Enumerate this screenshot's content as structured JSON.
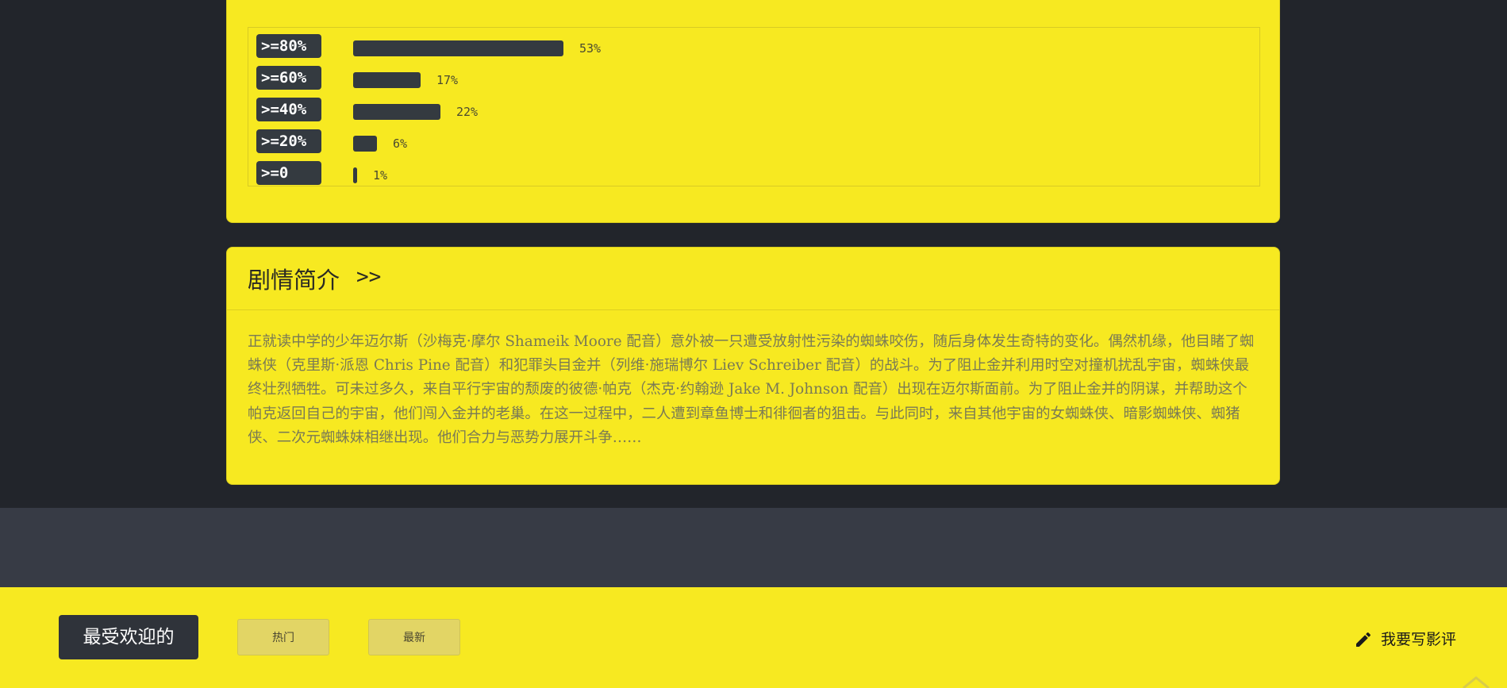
{
  "ratings": [
    {
      "label": ">=80%",
      "percent": 53,
      "percent_text": "53%"
    },
    {
      "label": ">=60%",
      "percent": 17,
      "percent_text": "17%"
    },
    {
      "label": ">=40%",
      "percent": 22,
      "percent_text": "22%"
    },
    {
      "label": ">=20%",
      "percent": 6,
      "percent_text": "6%"
    },
    {
      "label": ">=0",
      "percent": 1,
      "percent_text": "1%"
    }
  ],
  "plot": {
    "title": "剧情简介",
    "arrow": ">>",
    "text": "正就读中学的少年迈尔斯（沙梅克·摩尔 Shameik Moore 配音）意外被一只遭受放射性污染的蜘蛛咬伤，随后身体发生奇特的变化。偶然机缘，他目睹了蜘蛛侠（克里斯·派恩 Chris Pine 配音）和犯罪头目金并（列维·施瑞博尔 Liev Schreiber 配音）的战斗。为了阻止金并利用时空对撞机扰乱宇宙，蜘蛛侠最终壮烈牺牲。可未过多久，来自平行宇宙的颓废的彼德·帕克（杰克·约翰逊 Jake M. Johnson 配音）出现在迈尔斯面前。为了阻止金并的阴谋，并帮助这个帕克返回自己的宇宙，他们闯入金并的老巢。在这一过程中，二人遭到章鱼博士和徘徊者的狙击。与此同时，来自其他宇宙的女蜘蛛侠、暗影蜘蛛侠、蜘猪侠、二次元蜘蛛妹相继出现。他们合力与恶势力展开斗争……"
  },
  "footer": {
    "popular_label": "最受欢迎的",
    "tab_hot": "热门",
    "tab_new": "最新",
    "write_review": "我要写影评",
    "write_icon": "pencil-icon"
  },
  "colors": {
    "accent_yellow": "#f7e921",
    "dark": "#343a40",
    "background": "#22252b"
  }
}
